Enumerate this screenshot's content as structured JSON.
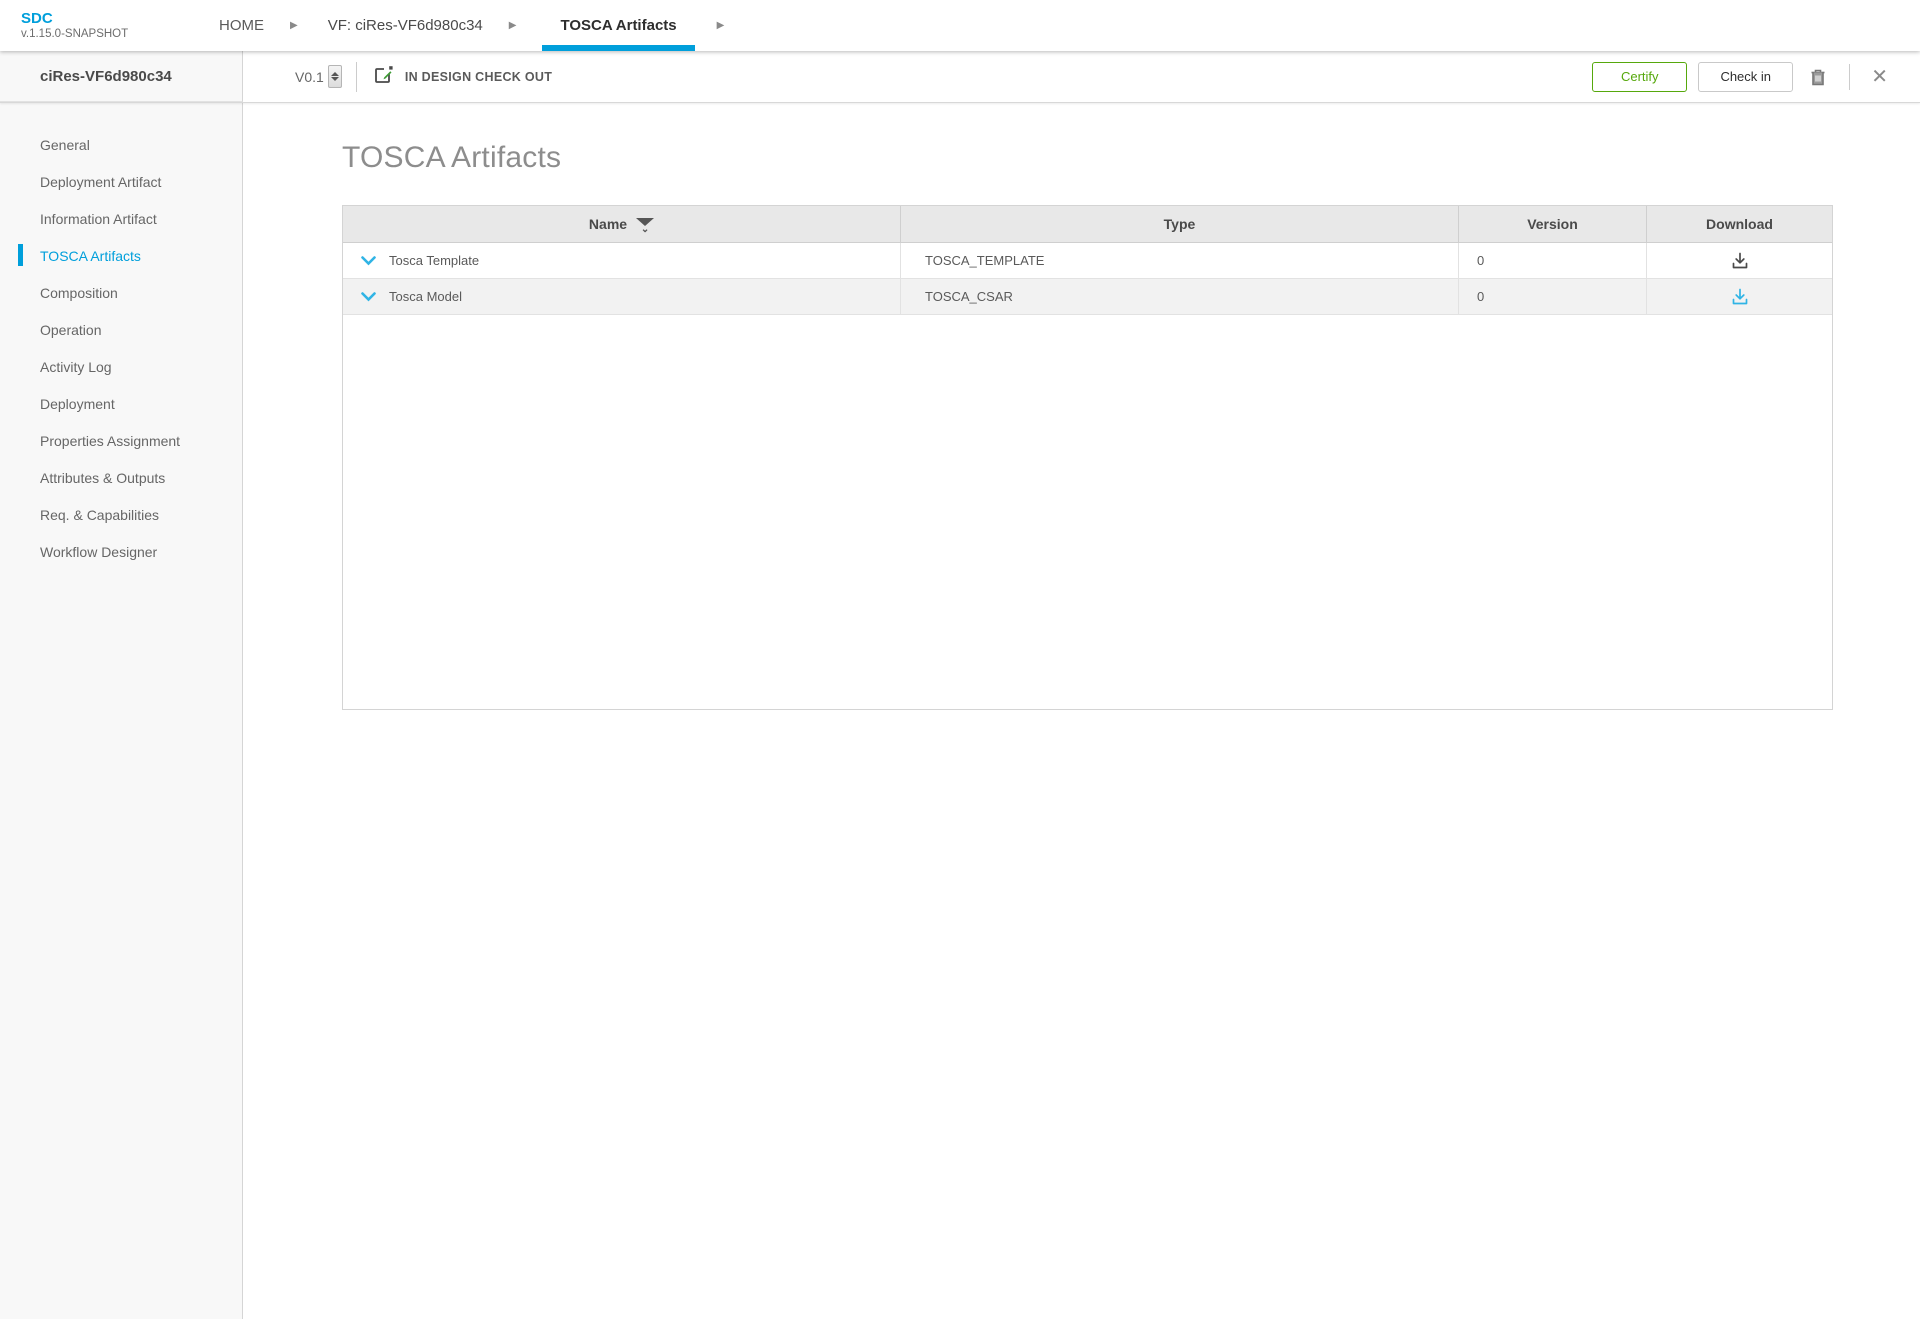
{
  "app": {
    "logo": "SDC",
    "version": "v.1.15.0-SNAPSHOT"
  },
  "breadcrumbs": {
    "home": "HOME",
    "vf": "VF: ciRes-VF6d980c34",
    "current": "TOSCA Artifacts"
  },
  "toolbar": {
    "version": "V0.1",
    "status": "IN DESIGN CHECK OUT",
    "certify_label": "Certify",
    "checkin_label": "Check in"
  },
  "sidebar": {
    "title": "ciRes-VF6d980c34",
    "items": [
      {
        "label": "General"
      },
      {
        "label": "Deployment Artifact"
      },
      {
        "label": "Information Artifact"
      },
      {
        "label": "TOSCA Artifacts",
        "active": true
      },
      {
        "label": "Composition"
      },
      {
        "label": "Operation"
      },
      {
        "label": "Activity Log"
      },
      {
        "label": "Deployment"
      },
      {
        "label": "Properties Assignment"
      },
      {
        "label": "Attributes & Outputs"
      },
      {
        "label": "Req. & Capabilities"
      },
      {
        "label": "Workflow Designer"
      }
    ]
  },
  "main": {
    "title": "TOSCA Artifacts",
    "table": {
      "headers": [
        "Name",
        "Type",
        "Version",
        "Download"
      ],
      "rows": [
        {
          "name": "Tosca Template",
          "type": "TOSCA_TEMPLATE",
          "version": "0",
          "download_color": "#4a4a4a"
        },
        {
          "name": "Tosca Model",
          "type": "TOSCA_CSAR",
          "version": "0",
          "download_color": "#30b4e5"
        }
      ]
    }
  },
  "colors": {
    "accent": "#009fdb",
    "green": "#56a80c",
    "icon_blue": "#30b4e5"
  }
}
